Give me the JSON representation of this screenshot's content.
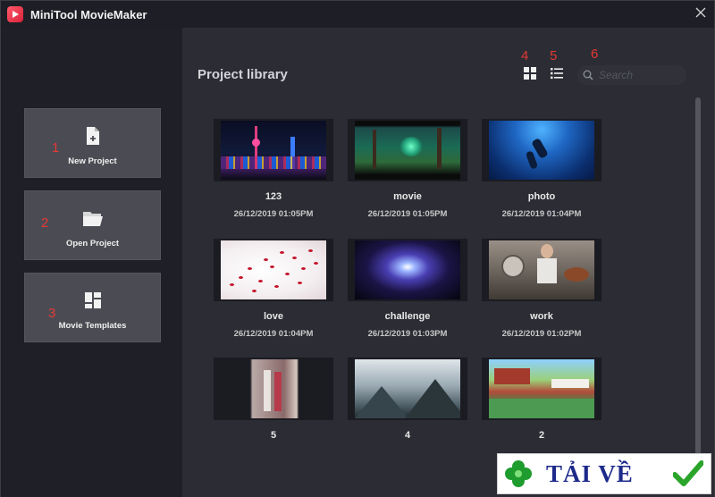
{
  "window": {
    "title": "MiniTool MovieMaker",
    "close_icon": "close-icon",
    "logo_icon": "play-logo-icon"
  },
  "sidebar": {
    "actions": [
      {
        "label": "New Project",
        "icon": "new-file-icon",
        "annotation": "1"
      },
      {
        "label": "Open Project",
        "icon": "folder-icon",
        "annotation": "2"
      },
      {
        "label": "Movie Templates",
        "icon": "templates-icon",
        "annotation": "3"
      }
    ]
  },
  "library": {
    "title": "Project library",
    "view_grid_annotation": "4",
    "view_list_annotation": "5",
    "search_annotation": "6",
    "search_placeholder": "Search",
    "projects": [
      {
        "name": "123",
        "date": "26/12/2019  01:05PM"
      },
      {
        "name": "movie",
        "date": "26/12/2019  01:05PM"
      },
      {
        "name": "photo",
        "date": "26/12/2019  01:04PM"
      },
      {
        "name": "love",
        "date": "26/12/2019  01:04PM"
      },
      {
        "name": "challenge",
        "date": "26/12/2019  01:03PM"
      },
      {
        "name": "work",
        "date": "26/12/2019  01:02PM"
      },
      {
        "name": "5",
        "date": ""
      },
      {
        "name": "4",
        "date": ""
      },
      {
        "name": "2",
        "date": ""
      }
    ]
  },
  "watermark": {
    "text": "TẢI VỀ"
  },
  "colors": {
    "accent": "#e53935",
    "background": "#2b2c34",
    "sidebar": "#1f2027",
    "card": "#4b4c53"
  }
}
